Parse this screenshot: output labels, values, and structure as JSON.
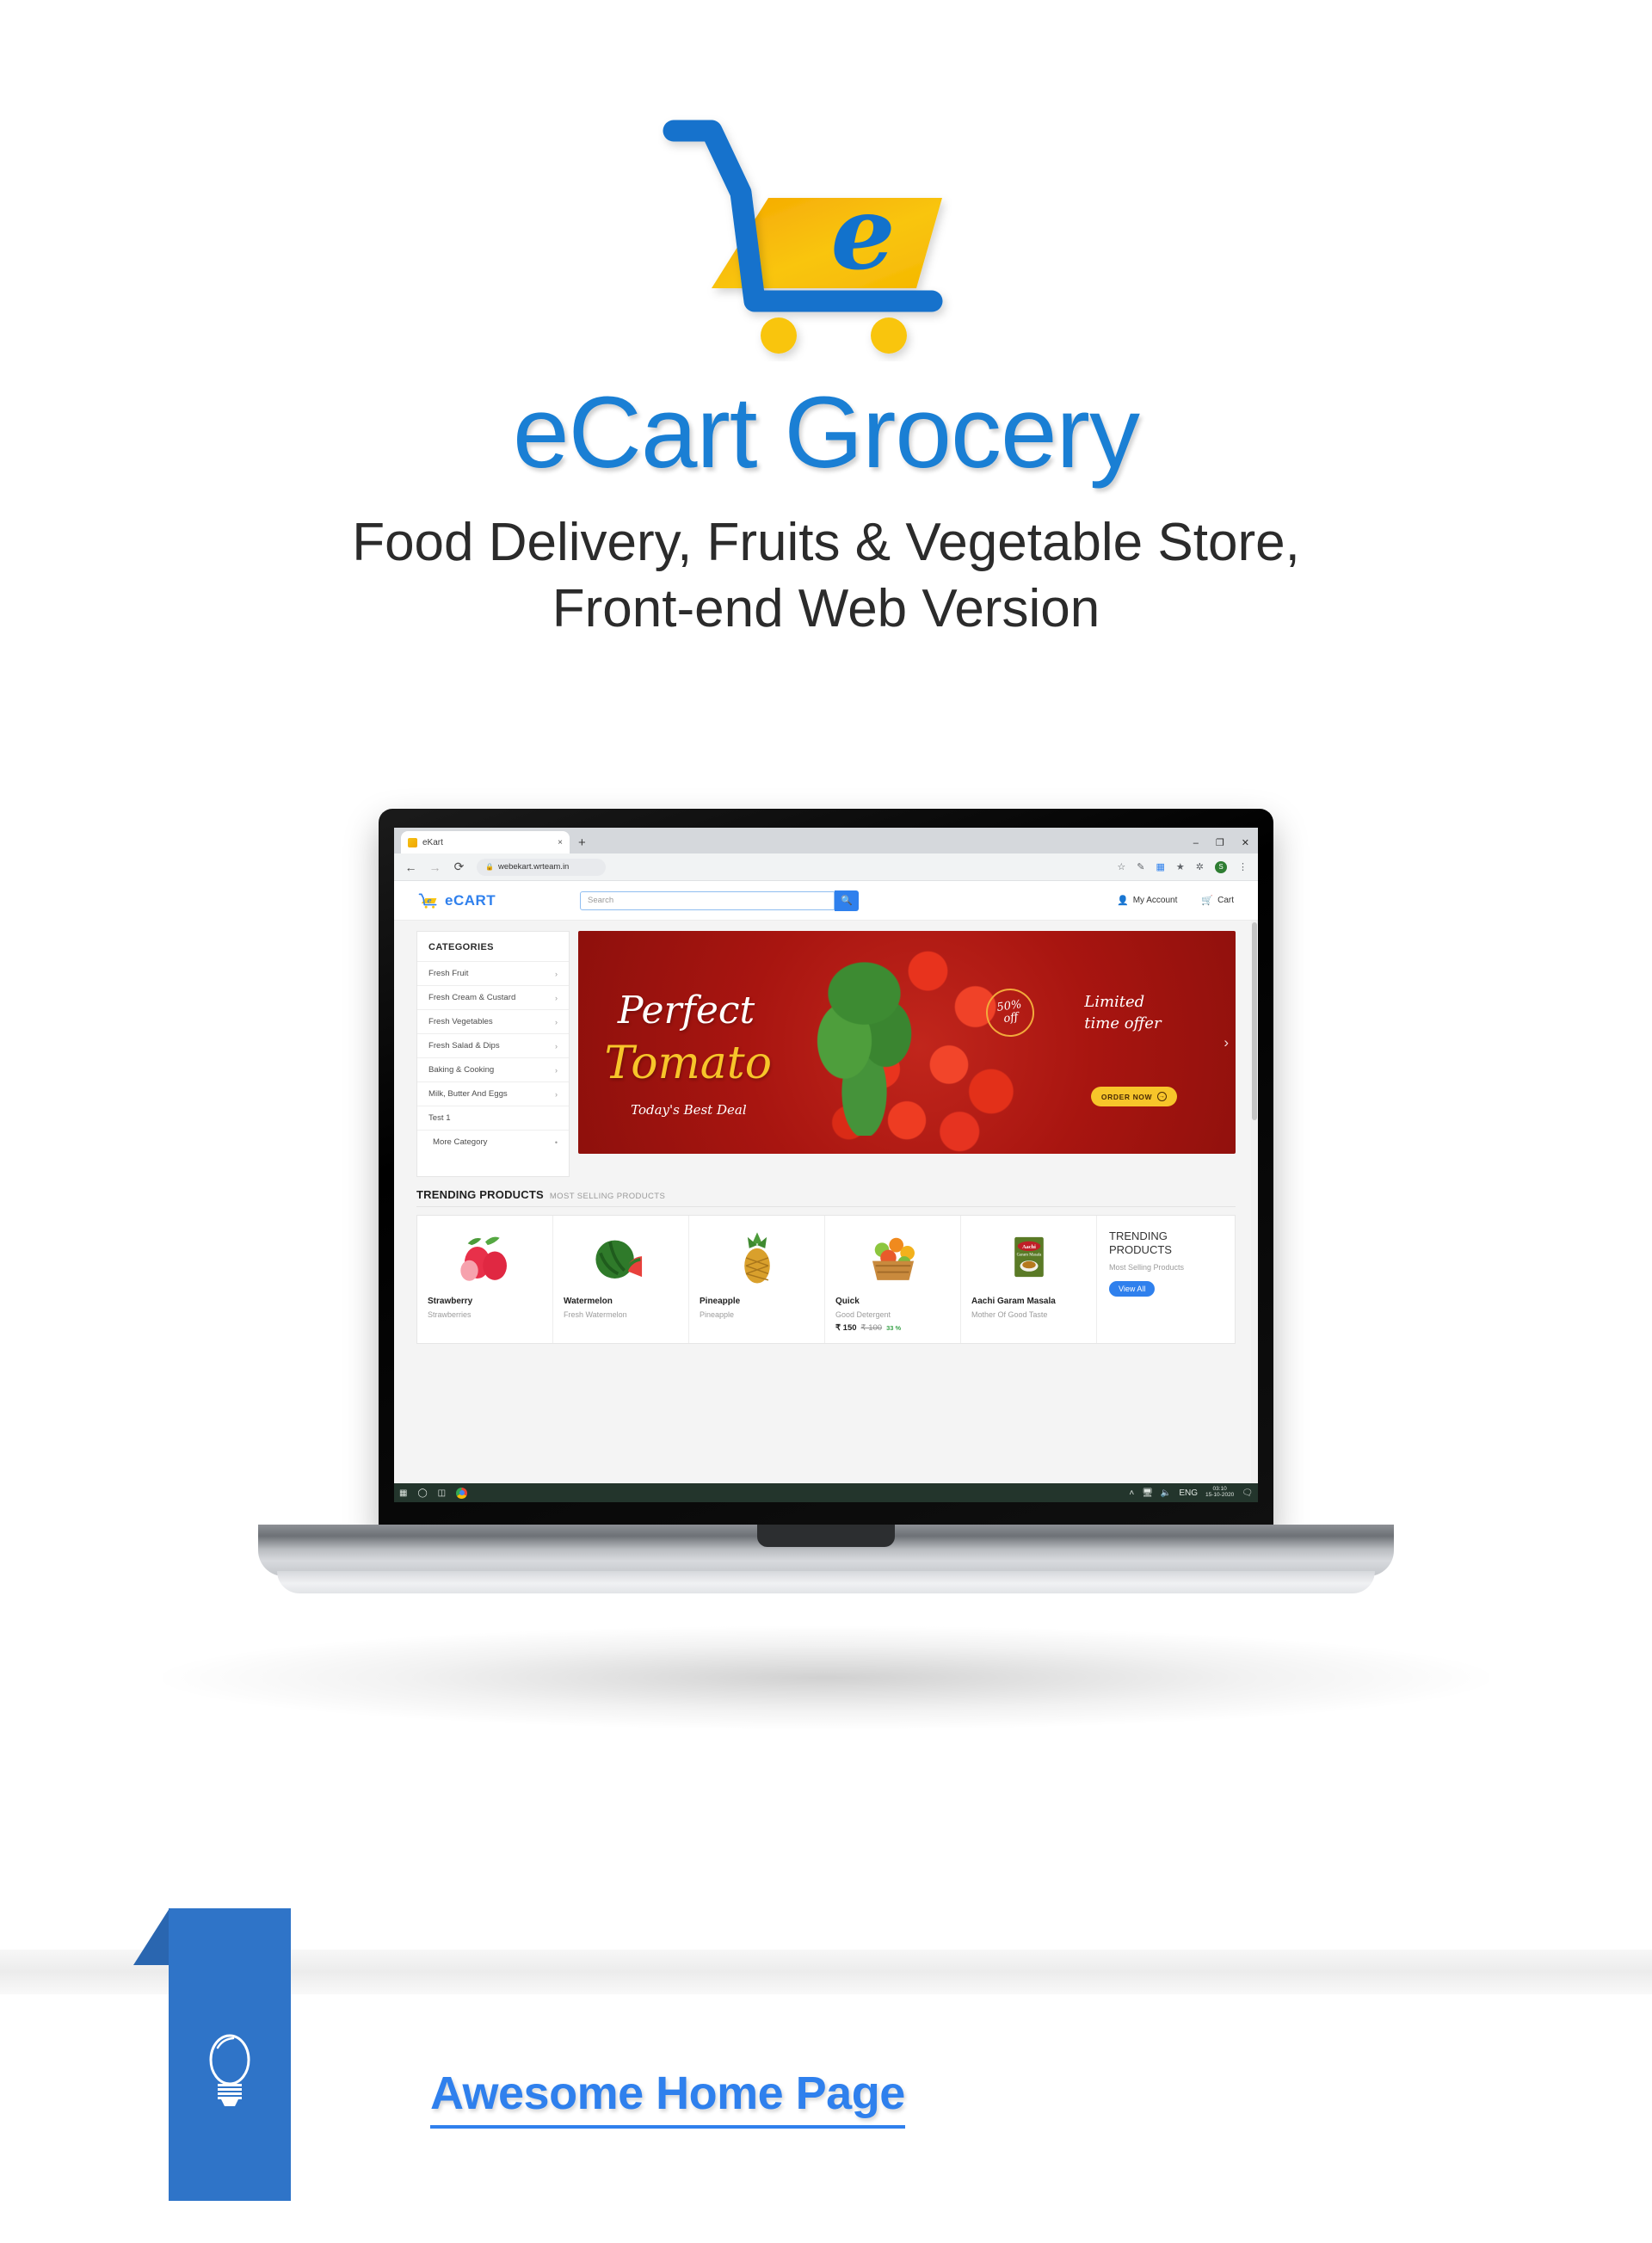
{
  "hero": {
    "logo_icon": "shopping-cart-logo",
    "title": "eCart Grocery",
    "subtitle_line1": "Food Delivery, Fruits & Vegetable Store,",
    "subtitle_line2": "Front-end Web Version",
    "title_color": "#1a7fd4",
    "subtitle_color": "#2b2b2b"
  },
  "browser": {
    "tab_title": "eKart",
    "tab_close": "×",
    "new_tab": "+",
    "back": "←",
    "forward": "→",
    "reload": "⟳",
    "lock_icon": "🔒",
    "url": "webekart.wrteam.in",
    "minimize": "–",
    "maximize": "❐",
    "close": "✕",
    "extensions": [
      "star-icon",
      "eyedropper-icon",
      "bookmark-icon",
      "shield-icon",
      "puzzle-icon"
    ],
    "profile_initial": "S",
    "menu": "⋮"
  },
  "site": {
    "logo_text_a": "e",
    "logo_text_b": "C",
    "logo_text_c": "ART",
    "search": {
      "placeholder": "Search",
      "value": "",
      "button_icon": "search-icon"
    },
    "account_label": "My Account",
    "cart_label": "Cart",
    "categories": {
      "title": "CATEGORIES",
      "items": [
        {
          "label": "Fresh Fruit",
          "chev": "›"
        },
        {
          "label": "Fresh Cream & Custard",
          "chev": "›"
        },
        {
          "label": "Fresh Vegetables",
          "chev": "›"
        },
        {
          "label": "Fresh Salad & Dips",
          "chev": "›"
        },
        {
          "label": "Baking & Cooking",
          "chev": "›"
        },
        {
          "label": "Milk, Butter And Eggs",
          "chev": "›"
        },
        {
          "label": "Test 1",
          "chev": ""
        }
      ],
      "more_label": "More Category",
      "more_icon": "•"
    },
    "banner": {
      "kicker": "Perfect",
      "main": "Tomato",
      "tagline": "Today's Best Deal",
      "badge_line1": "50%",
      "badge_line2": "off",
      "limited_line1": "Limited",
      "limited_line2": "time offer",
      "cta_label": "ORDER NOW",
      "cta_icon": "→",
      "next_arrow": "›",
      "bg_color": "#a81510"
    },
    "trending": {
      "heading": "TRENDING PRODUCTS",
      "subheading": "MOST SELLING PRODUCTS",
      "products": [
        {
          "name": "Strawberry",
          "desc": "Strawberries",
          "price": "",
          "old_price": "",
          "off": "",
          "image": "strawberry-image"
        },
        {
          "name": "Watermelon",
          "desc": "Fresh Watermelon",
          "price": "",
          "old_price": "",
          "off": "",
          "image": "watermelon-image"
        },
        {
          "name": "Pineapple",
          "desc": "Pineapple",
          "price": "",
          "old_price": "",
          "off": "",
          "image": "pineapple-image"
        },
        {
          "name": "Quick",
          "desc": "Good Detergent",
          "price": "₹ 150",
          "old_price": "₹ 100",
          "off": "33 %",
          "image": "fruit-basket-image"
        },
        {
          "name": "Aachi Garam Masala",
          "desc": "Mother Of Good Taste",
          "price": "",
          "old_price": "",
          "off": "",
          "image": "garam-masala-image"
        }
      ],
      "promo": {
        "title": "TRENDING PRODUCTS",
        "subtitle": "Most Selling Products",
        "button": "View All"
      }
    }
  },
  "taskbar": {
    "start_icon": "windows-icon",
    "search_icon": "search-circle-icon",
    "taskview_icon": "task-view-icon",
    "chrome_icon": "chrome-icon",
    "chevron": "˄",
    "monitor_icon": "⬜",
    "sound_icon": "🔊",
    "language": "ENG",
    "time": "03:10",
    "date": "15-10-2020",
    "notification_icon": "💬"
  },
  "footer": {
    "icon": "lightbulb-icon",
    "label": "Awesome Home Page",
    "ribbon_color": "#2f74c8",
    "label_color": "#2f80ed"
  }
}
